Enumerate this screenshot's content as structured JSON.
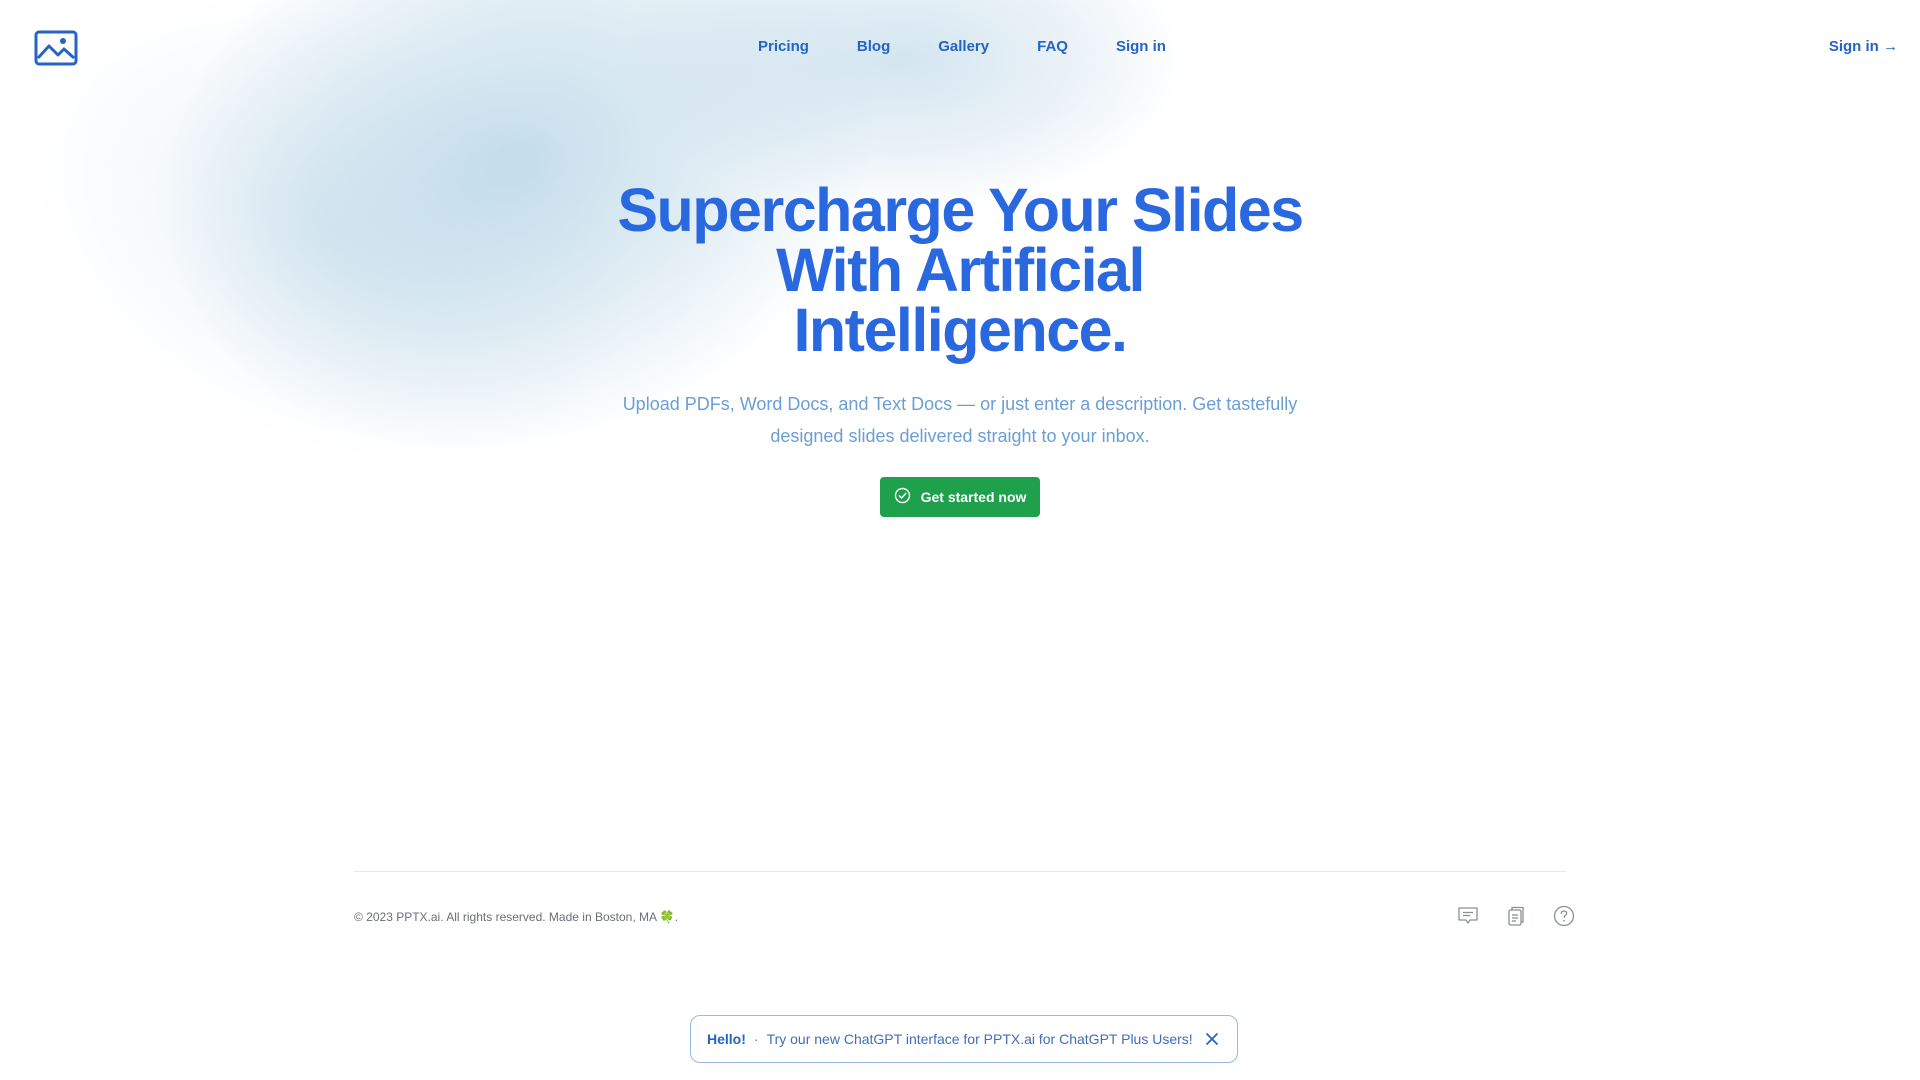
{
  "nav": {
    "items": [
      "Pricing",
      "Blog",
      "Gallery",
      "FAQ",
      "Sign in"
    ],
    "signin_right": "Sign in →"
  },
  "hero": {
    "headline": "Supercharge Your Slides With Artificial Intelligence.",
    "subtext": "Upload PDFs, Word Docs, and Text Docs — or just enter a description. Get tastefully designed slides delivered straight to your inbox.",
    "cta_label": "Get started now"
  },
  "footer": {
    "copyright": "© 2023 PPTX.ai. All rights reserved. Made in Boston, MA 🍀.",
    "icons": [
      "chat-icon",
      "clipboard-icon",
      "help-icon"
    ]
  },
  "notice": {
    "hello": "Hello!",
    "separator": "·",
    "message": "Try our new ChatGPT interface for PPTX.ai for ChatGPT Plus Users!"
  },
  "colors": {
    "accent": "#2a68e0",
    "nav_text": "#2563c4",
    "subtext": "#6a9ed6",
    "cta_bg": "#1ea04d"
  }
}
